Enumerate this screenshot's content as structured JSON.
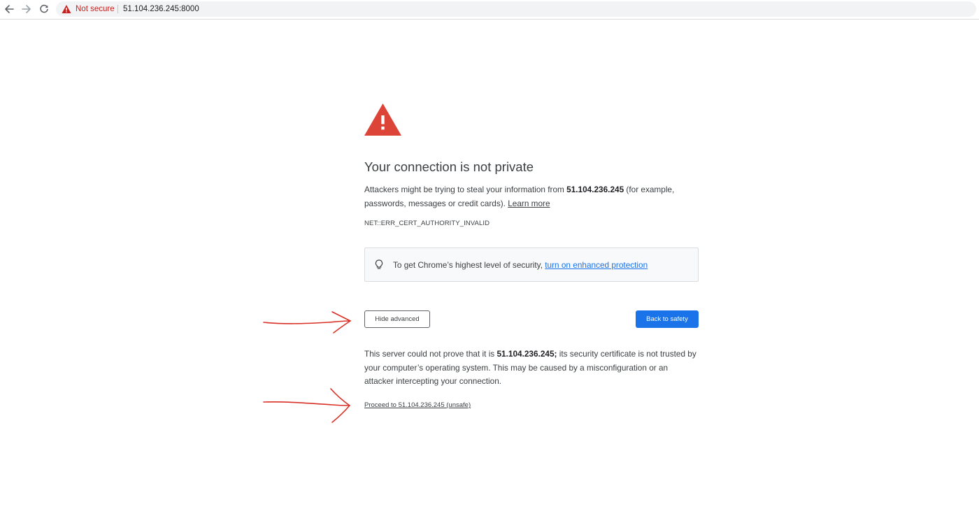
{
  "browser": {
    "security_status": "Not secure",
    "url": "51.104.236.245:8000"
  },
  "interstitial": {
    "heading": "Your connection is not private",
    "intro_part1": "Attackers might be trying to steal your information from ",
    "host": "51.104.236.245",
    "intro_part2": " (for example, passwords, messages or credit cards). ",
    "learn_more": "Learn more",
    "error_code": "NET::ERR_CERT_AUTHORITY_INVALID",
    "enhanced_text": "To get Chrome’s highest level of security, ",
    "enhanced_link": "turn on enhanced protection",
    "hide_advanced_label": "Hide advanced",
    "back_to_safety_label": "Back to safety",
    "details_part1": "This server could not prove that it is ",
    "details_host": "51.104.236.245;",
    "details_part2": " its security certificate is not trusted by your computer’s operating system. This may be caused by a misconfiguration or an attacker intercepting your connection.",
    "proceed_link": "Proceed to 51.104.236.245 (unsafe)"
  },
  "colors": {
    "warning_red": "#db4437",
    "link_blue": "#1a73e8",
    "primary_button": "#1a73e8",
    "annotation_red": "#d93025"
  },
  "icons": [
    "back-arrow-icon",
    "forward-arrow-icon",
    "reload-icon",
    "warning-triangle-icon",
    "lightbulb-icon"
  ]
}
